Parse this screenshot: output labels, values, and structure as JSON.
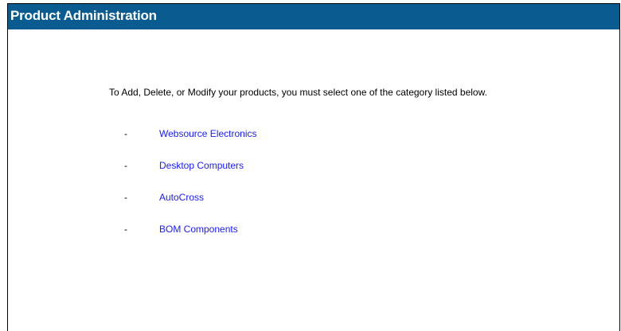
{
  "header": {
    "title": "Product Administration",
    "background_color": "#0a5b8f"
  },
  "intro": {
    "text": "To Add, Delete, or Modify your products, you must select one of the category listed below."
  },
  "categories": [
    {
      "bullet": "-",
      "label": "Websource Electronics"
    },
    {
      "bullet": "-",
      "label": "Desktop Computers"
    },
    {
      "bullet": "-",
      "label": "AutoCross"
    },
    {
      "bullet": "-",
      "label": "BOM Components"
    }
  ],
  "colors": {
    "link": "#1a1aff",
    "text": "#000000"
  }
}
